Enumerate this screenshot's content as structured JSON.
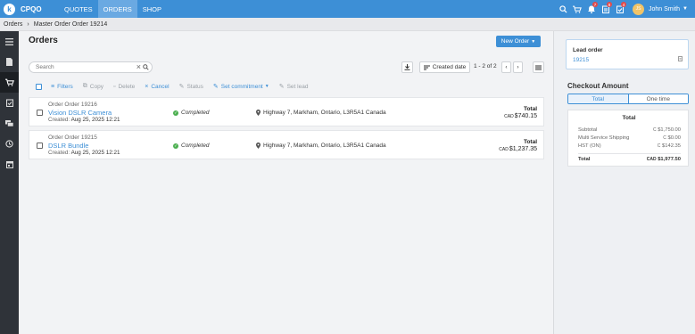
{
  "topbar": {
    "logo_letter": "k",
    "app_name": "CPQO",
    "tabs": [
      {
        "label": "QUOTES"
      },
      {
        "label": "ORDERS"
      },
      {
        "label": "SHOP"
      }
    ],
    "badges": {
      "notifications": "7",
      "tasks": "8",
      "approvals": "4"
    },
    "user": {
      "initials": "JS",
      "name": "John Smith"
    }
  },
  "breadcrumb": {
    "root": "Orders",
    "current": "Master Order Order 19214"
  },
  "main": {
    "title": "Orders",
    "new_order_label": "New Order",
    "search_placeholder": "Search",
    "sort_label": "Created date",
    "paging": "1 - 2 of 2",
    "actions": {
      "filters": "Filters",
      "copy": "Copy",
      "delete": "Delete",
      "cancel": "Cancel",
      "status": "Status",
      "set_commitment": "Set commitment",
      "set_lead": "Set lead"
    },
    "orders": [
      {
        "sub": "Order Order 19216",
        "name": "Vision DSLR Camera",
        "created_label": "Created:",
        "created": "Aug 25, 2025 12:21",
        "status": "Completed",
        "address": "Highway 7, Markham, Ontario, L3R5A1 Canada",
        "total_label": "Total",
        "currency": "CAD",
        "total": "$740.15"
      },
      {
        "sub": "Order Order 19215",
        "name": "DSLR Bundle",
        "created_label": "Created:",
        "created": "Aug 25, 2025 12:21",
        "status": "Completed",
        "address": "Highway 7, Markham, Ontario, L3R5A1 Canada",
        "total_label": "Total",
        "currency": "CAD",
        "total": "$1,237.35"
      }
    ]
  },
  "right_panel": {
    "lead_title": "Lead order",
    "lead_value": "19215",
    "checkout_title": "Checkout Amount",
    "segments": [
      "Total",
      "One time"
    ],
    "summary_title": "Total",
    "rows": [
      {
        "label": "Subtotal",
        "currency": "C",
        "value": "$1,750.00"
      },
      {
        "label": "Multi Service Shipping",
        "currency": "C",
        "value": "$0.00"
      },
      {
        "label": "HST (ON)",
        "currency": "C",
        "value": "$142.35"
      }
    ],
    "total_row": {
      "label": "Total",
      "currency": "CAD",
      "value": "$1,977.50"
    }
  },
  "colors": {
    "brand": "#3d8fd6",
    "sidebar": "#2f3339",
    "status_completed": "#4caf50",
    "badge": "#e24a4a"
  }
}
